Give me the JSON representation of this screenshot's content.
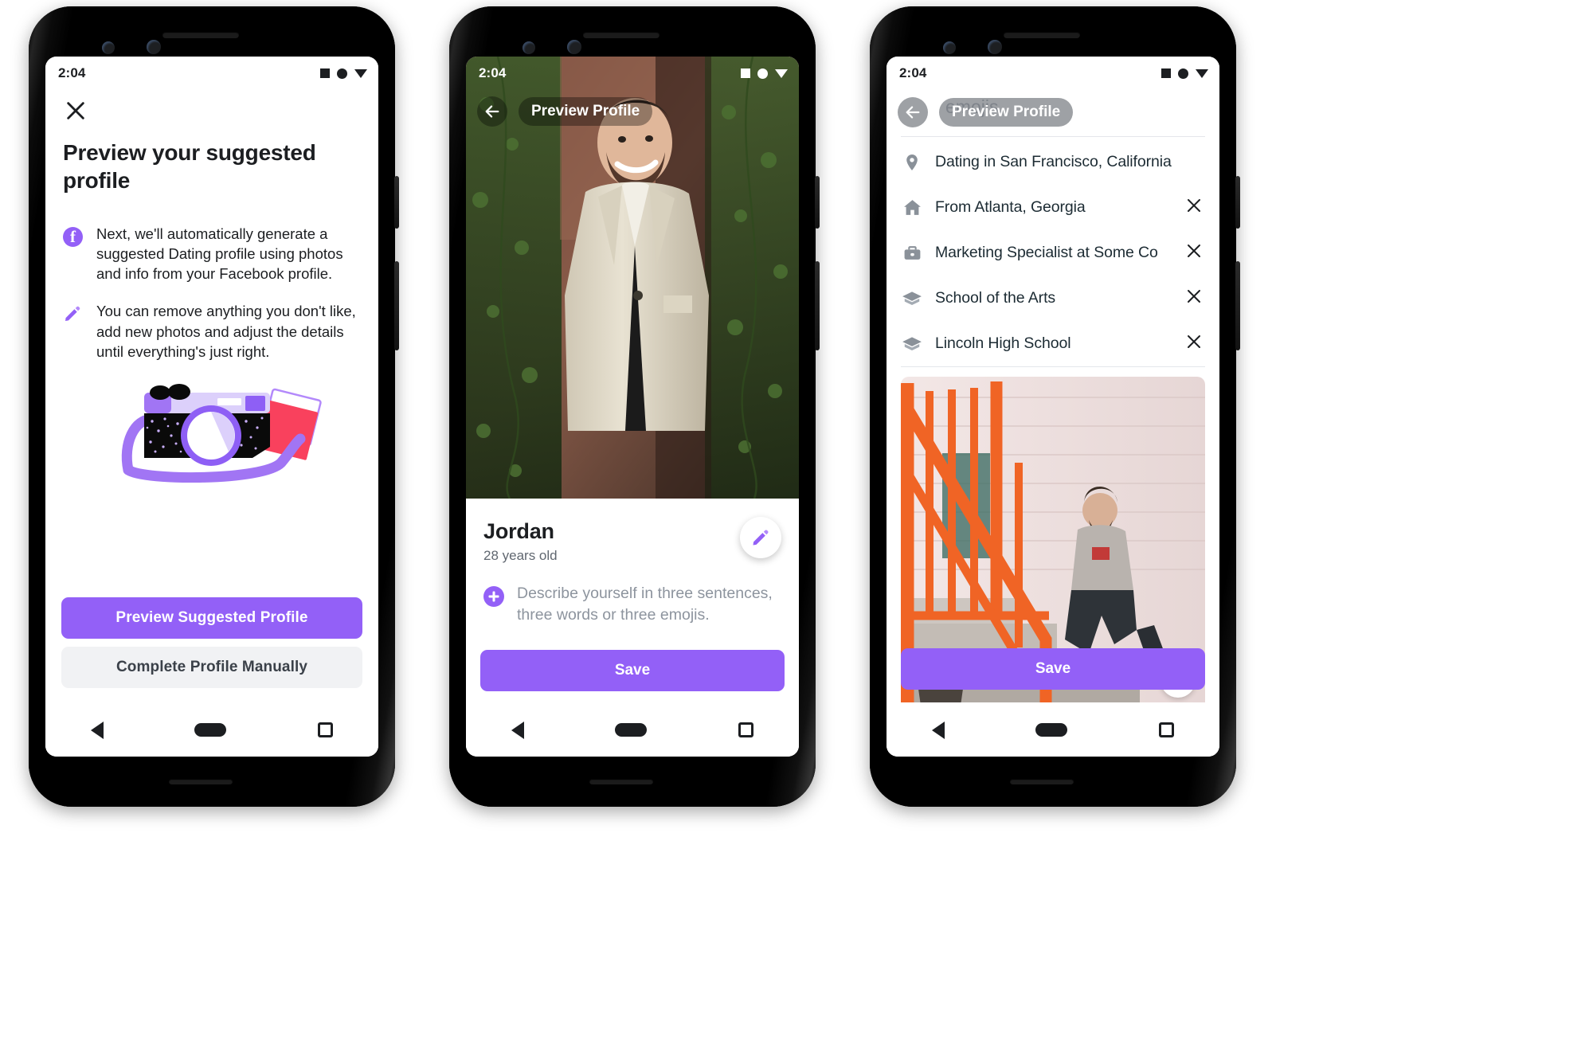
{
  "colors": {
    "accent": "#9360f7",
    "text_primary": "#1c1e21",
    "text_secondary": "#606770",
    "placeholder": "#8d949e",
    "button_secondary_bg": "#f1f2f4"
  },
  "phone1": {
    "status": {
      "time": "2:04",
      "icons": [
        "square-icon",
        "circle-icon",
        "triangle-down-icon"
      ]
    },
    "close_icon": "close-icon",
    "title": "Preview your suggested profile",
    "bullets": [
      {
        "icon": "facebook-icon",
        "text": "Next, we'll automatically generate a suggested Dating profile using photos and info from your Facebook profile."
      },
      {
        "icon": "pencil-icon",
        "text": "You can remove anything you don't like, add new photos and adjust the details until everything's just right."
      }
    ],
    "illustration": "camera-and-photos-illustration",
    "primary_button": "Preview Suggested Profile",
    "secondary_button": "Complete Profile Manually",
    "nav": [
      "back-triangle",
      "home-pill",
      "recents-square"
    ]
  },
  "phone2": {
    "status": {
      "time": "2:04",
      "icons": [
        "square-icon",
        "circle-icon",
        "triangle-down-icon"
      ]
    },
    "back_icon": "arrow-left-icon",
    "header_title": "Preview Profile",
    "photo": "man-in-cream-blazer-against-ivy-wall",
    "name": "Jordan",
    "age": "28 years old",
    "prompt_icon": "plus-circle-icon",
    "prompt_text": "Describe yourself in three sentences, three words or three emojis.",
    "edit_fab_icon": "pencil-icon",
    "save_button": "Save",
    "nav": [
      "back-triangle",
      "home-pill",
      "recents-square"
    ]
  },
  "phone3": {
    "status": {
      "time": "2:04",
      "icons": [
        "square-icon",
        "circle-icon",
        "triangle-down-icon"
      ]
    },
    "scrolled_text": "emojis.",
    "back_icon": "arrow-left-icon",
    "header_title": "Preview Profile",
    "details": [
      {
        "icon": "location-pin-icon",
        "label": "Dating in San Francisco, California",
        "removable": false
      },
      {
        "icon": "home-icon",
        "label": "From Atlanta, Georgia",
        "removable": true
      },
      {
        "icon": "briefcase-icon",
        "label": "Marketing Specialist at Some Co",
        "removable": true
      },
      {
        "icon": "graduation-cap-icon",
        "label": "School of the Arts",
        "removable": true
      },
      {
        "icon": "graduation-cap-icon",
        "label": "Lincoln High School",
        "removable": true
      }
    ],
    "remove_icon": "close-icon",
    "photo": "man-sitting-on-steps-with-orange-handrail",
    "save_button": "Save",
    "nav": [
      "back-triangle",
      "home-pill",
      "recents-square"
    ]
  }
}
